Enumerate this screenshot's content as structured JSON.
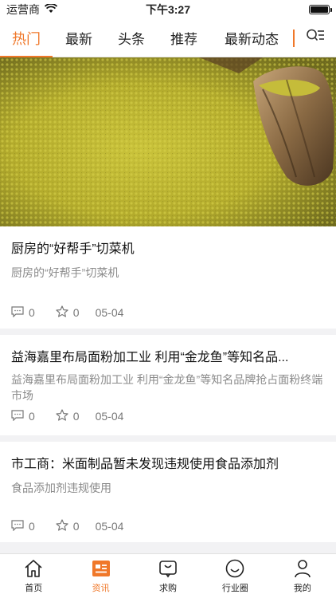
{
  "status_bar": {
    "carrier": "运营商",
    "time": "下午3:27",
    "battery_level": 1.0
  },
  "tabs": [
    {
      "label": "热门",
      "active": true
    },
    {
      "label": "最新",
      "active": false
    },
    {
      "label": "头条",
      "active": false
    },
    {
      "label": "推荐",
      "active": false
    },
    {
      "label": "最新动态",
      "active": false
    }
  ],
  "articles": [
    {
      "title": "厨房的“好帮手”切菜机",
      "summary": "厨房的“好帮手”切菜机",
      "comments": "0",
      "likes": "0",
      "date": "05-04"
    },
    {
      "title": "益海嘉里布局面粉加工业 利用“金龙鱼”等知名品...",
      "summary": "益海嘉里布局面粉加工业 利用“金龙鱼”等知名品牌抢占面粉终端市场",
      "comments": "0",
      "likes": "0",
      "date": "05-04"
    },
    {
      "title": "市工商：米面制品暂未发现违规使用食品添加剂",
      "summary": "食品添加剂违规使用",
      "comments": "0",
      "likes": "0",
      "date": "05-04"
    }
  ],
  "bottom_nav": [
    {
      "label": "首页",
      "icon": "home-icon",
      "active": false
    },
    {
      "label": "资讯",
      "icon": "news-icon",
      "active": true
    },
    {
      "label": "求购",
      "icon": "shopping-bag-icon",
      "active": false
    },
    {
      "label": "行业圈",
      "icon": "smile-circle-icon",
      "active": false
    },
    {
      "label": "我的",
      "icon": "person-icon",
      "active": false
    }
  ],
  "colors": {
    "accent": "#f0782a",
    "text": "#111111",
    "secondary_text": "#8b8b8b"
  }
}
